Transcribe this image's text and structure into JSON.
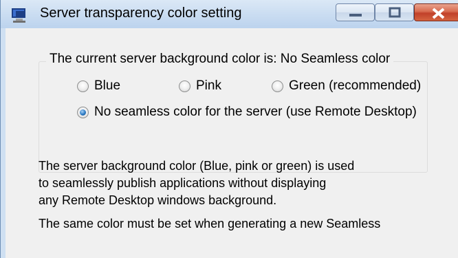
{
  "window": {
    "title": "Server transparency color setting"
  },
  "group": {
    "legend": "The current server background color is: No Seamless color"
  },
  "options": {
    "blue": "Blue",
    "pink": "Pink",
    "green": "Green (recommended)",
    "none": "No seamless color for the server (use Remote Desktop)",
    "selected": "none"
  },
  "description": {
    "line1": "The server background color (Blue, pink or green) is used",
    "line2": "to seamlessly publish applications without displaying",
    "line3": "any Remote Desktop windows background.",
    "line4": "The same color must be set when generating a new Seamless"
  },
  "icons": [
    "app-icon",
    "minimize-icon",
    "maximize-icon",
    "close-icon"
  ],
  "colors": {
    "titlebar": "#c9dcf1",
    "close_button": "#c1412a",
    "radio_selected": "#2b79c3",
    "client_background": "#f0f0f0"
  }
}
